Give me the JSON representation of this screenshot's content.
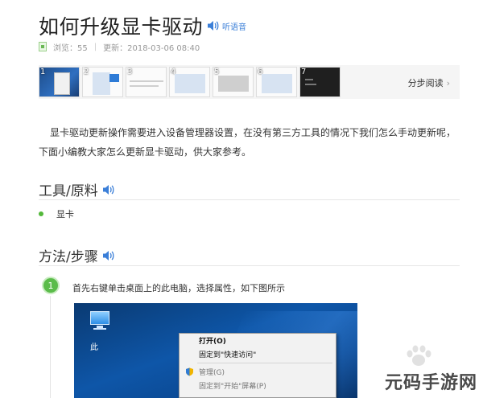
{
  "article": {
    "title": "如何升级显卡驱动",
    "listen_label": "听语音",
    "meta": {
      "views": "浏览：55",
      "updated": "更新：2018-03-06 08:40"
    }
  },
  "thumbnails": {
    "items": [
      {
        "num": "1",
        "style": "blue"
      },
      {
        "num": "2",
        "style": "light"
      },
      {
        "num": "3",
        "style": "light"
      },
      {
        "num": "4",
        "style": "light"
      },
      {
        "num": "5",
        "style": "light"
      },
      {
        "num": "6",
        "style": "light"
      },
      {
        "num": "7",
        "style": "dark"
      }
    ],
    "step_read_label": "分步阅读",
    "chevron_icon": "chevron-right-icon"
  },
  "intro": "显卡驱动更新操作需要进入设备管理器设置，在没有第三方工具的情况下我们怎么手动更新呢，下面小编教大家怎么更新显卡驱动，供大家参考。",
  "tools_section": {
    "title": "工具/原料",
    "items": [
      "显卡"
    ]
  },
  "method_section": {
    "title": "方法/步骤"
  },
  "steps": [
    {
      "num": "1",
      "text": "首先右键单击桌面上的此电脑，选择属性，如下图所示",
      "screenshot": {
        "desktop_icon_label": "此",
        "context_menu": [
          {
            "label": "打开(O)",
            "bold": true
          },
          {
            "label": "固定到\"快速访问\""
          },
          {
            "label": "管理(G)",
            "dim": true,
            "icon": "shield-icon"
          },
          {
            "label": "固定到\"开始\"屏幕(P)",
            "dim": true
          }
        ]
      }
    }
  ],
  "watermark": {
    "brand": "元码手游网"
  },
  "colors": {
    "accent_green": "#5bbc4a",
    "link_blue": "#3b7fd8"
  }
}
